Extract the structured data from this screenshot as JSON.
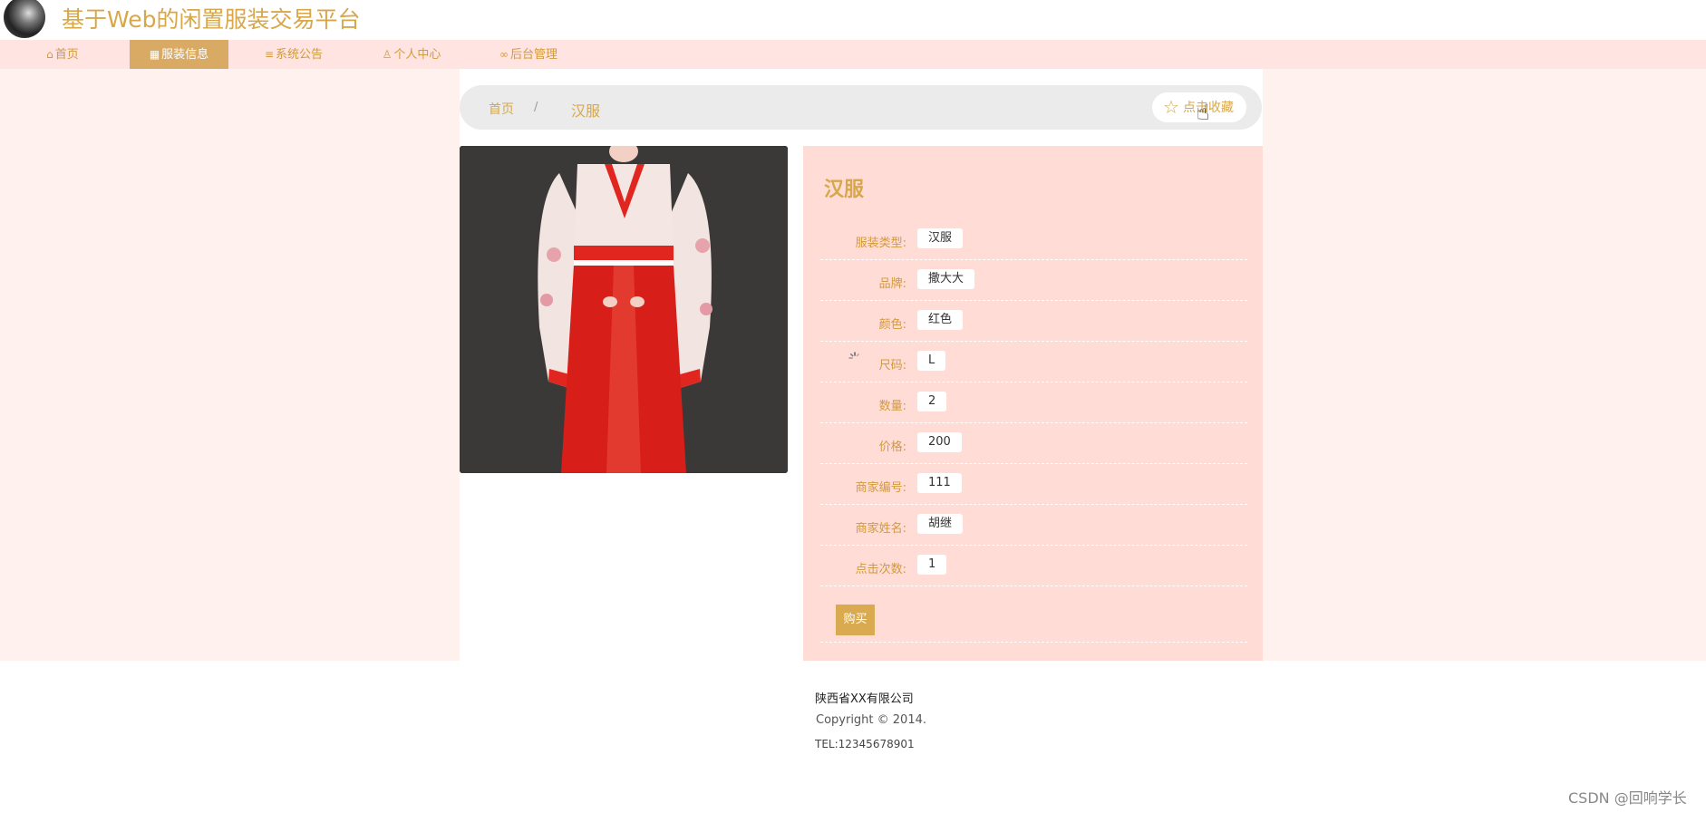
{
  "header": {
    "title": "基于Web的闲置服装交易平台"
  },
  "nav": {
    "items": [
      {
        "label": "首页",
        "icon": "home-icon"
      },
      {
        "label": "服装信息",
        "icon": "grid-icon",
        "active": true
      },
      {
        "label": "系统公告",
        "icon": "sliders-icon"
      },
      {
        "label": "个人中心",
        "icon": "user-icon"
      },
      {
        "label": "后台管理",
        "icon": "link-icon"
      }
    ]
  },
  "breadcrumb": {
    "home": "首页",
    "separator": "/",
    "current": "汉服"
  },
  "favorite": {
    "label": "点击收藏",
    "icon": "star-icon"
  },
  "product": {
    "title": "汉服",
    "fields": [
      {
        "key": "服装类型:",
        "value": "汉服"
      },
      {
        "key": "品牌:",
        "value": "撒大大"
      },
      {
        "key": "颜色:",
        "value": "红色"
      },
      {
        "key": "尺码:",
        "value": "L"
      },
      {
        "key": "数量:",
        "value": "2"
      },
      {
        "key": "价格:",
        "value": "200"
      },
      {
        "key": "商家编号:",
        "value": "111"
      },
      {
        "key": "商家姓名:",
        "value": "胡继"
      },
      {
        "key": "点击次数:",
        "value": "1"
      }
    ],
    "buy_label": "购买"
  },
  "footer": {
    "company": "陕西省XX有限公司",
    "copyright": "Copyright © 2014.",
    "tel": "TEL:12345678901"
  },
  "watermark": "CSDN @回响学长",
  "colors": {
    "accent": "#d8a74a",
    "nav_bg": "#ffe4e1",
    "card_bg": "#ffdcd6",
    "nav_active": "#d9aa63"
  }
}
